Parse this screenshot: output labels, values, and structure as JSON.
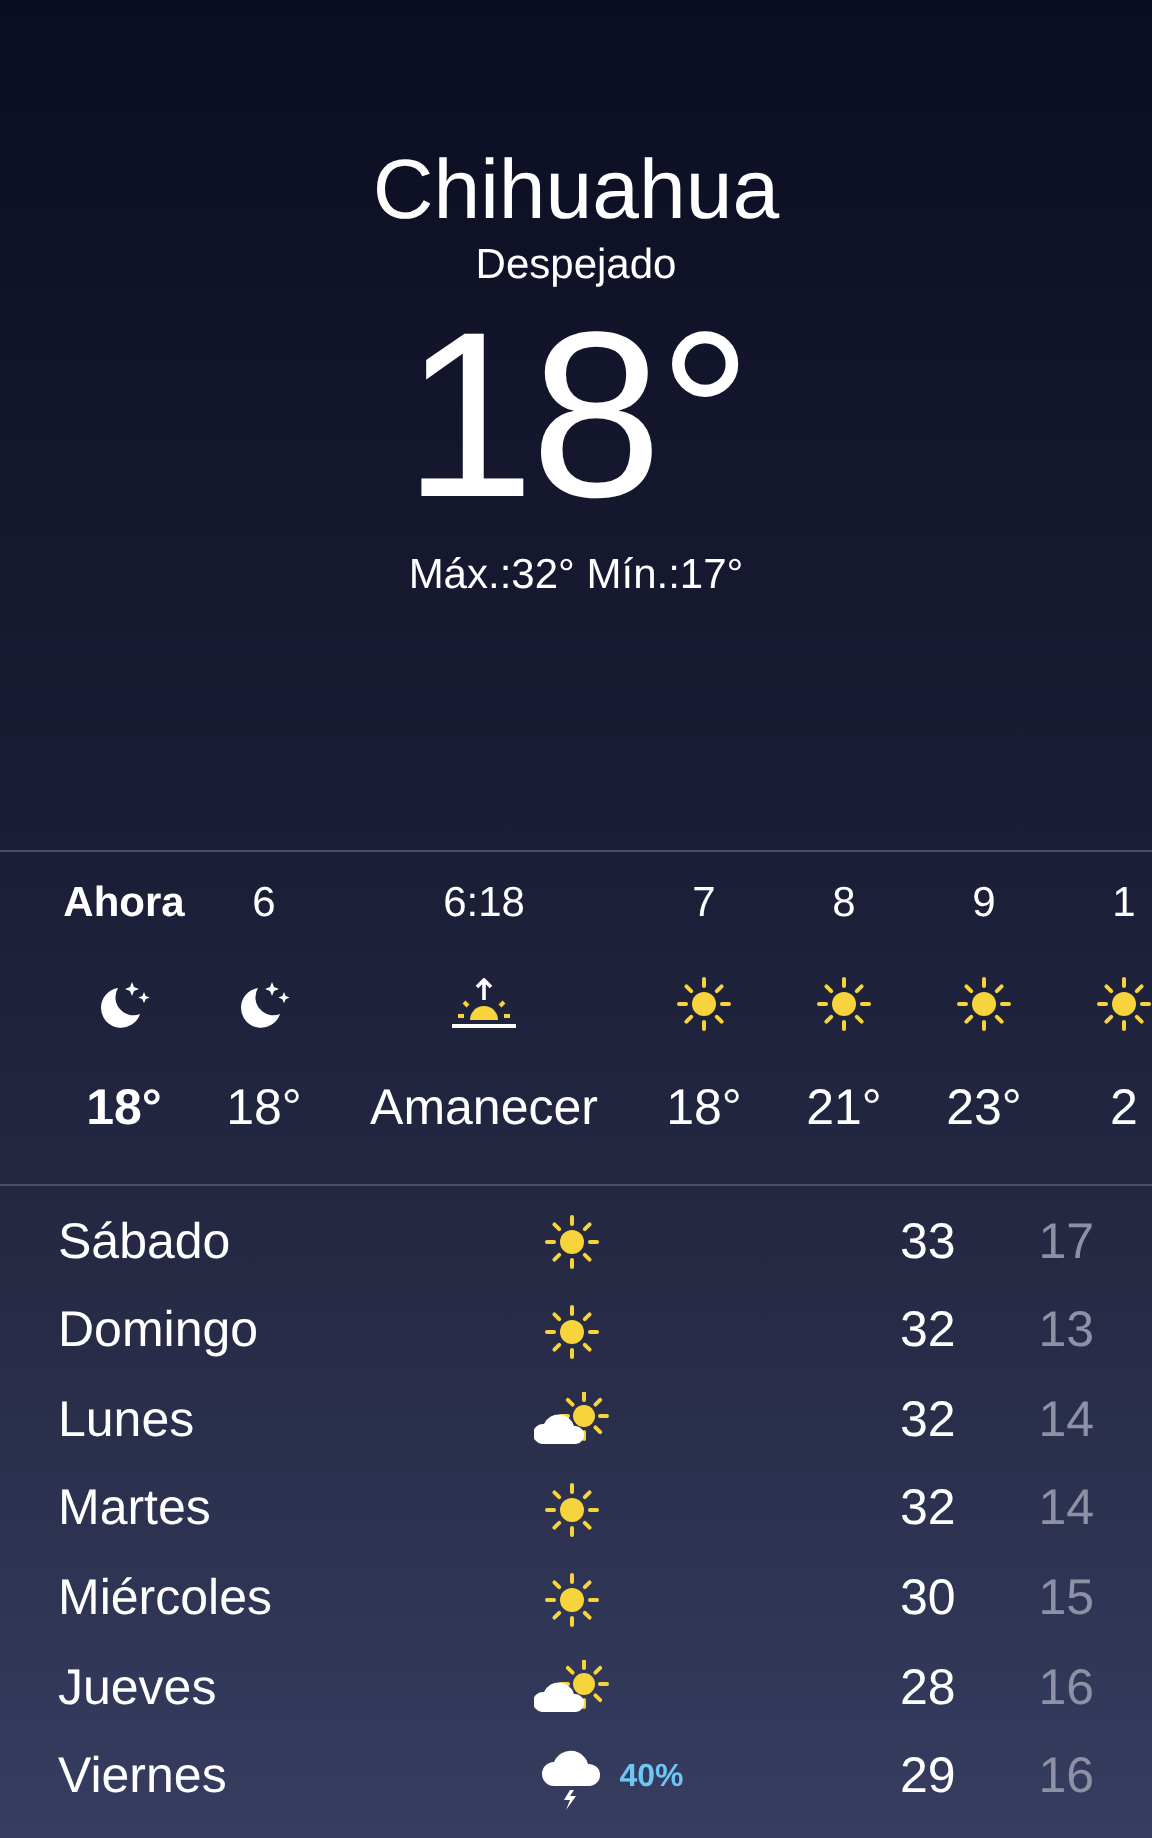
{
  "location": {
    "city": "Chihuahua",
    "condition": "Despejado",
    "temperature": "18°",
    "high_low": "Máx.:32° Mín.:17°"
  },
  "hourly": [
    {
      "time": "Ahora",
      "kind": "moon",
      "value": "18°",
      "current": true
    },
    {
      "time": "6",
      "kind": "moon",
      "value": "18°",
      "current": false
    },
    {
      "time": "6:18",
      "kind": "sunrise",
      "value": "Amanecer",
      "current": false
    },
    {
      "time": "7",
      "kind": "sun",
      "value": "18°",
      "current": false
    },
    {
      "time": "8",
      "kind": "sun",
      "value": "21°",
      "current": false
    },
    {
      "time": "9",
      "kind": "sun",
      "value": "23°",
      "current": false
    },
    {
      "time": "1",
      "kind": "sun",
      "value": "2",
      "current": false
    }
  ],
  "daily": [
    {
      "day": "Sábado",
      "kind": "sun",
      "high": "33",
      "low": "17"
    },
    {
      "day": "Domingo",
      "kind": "sun",
      "high": "32",
      "low": "13"
    },
    {
      "day": "Lunes",
      "kind": "partly",
      "high": "32",
      "low": "14"
    },
    {
      "day": "Martes",
      "kind": "sun",
      "high": "32",
      "low": "14"
    },
    {
      "day": "Miércoles",
      "kind": "sun",
      "high": "30",
      "low": "15"
    },
    {
      "day": "Jueves",
      "kind": "partly",
      "high": "28",
      "low": "16"
    },
    {
      "day": "Viernes",
      "kind": "storm",
      "precipitation": "40%",
      "high": "29",
      "low": "16"
    }
  ]
}
